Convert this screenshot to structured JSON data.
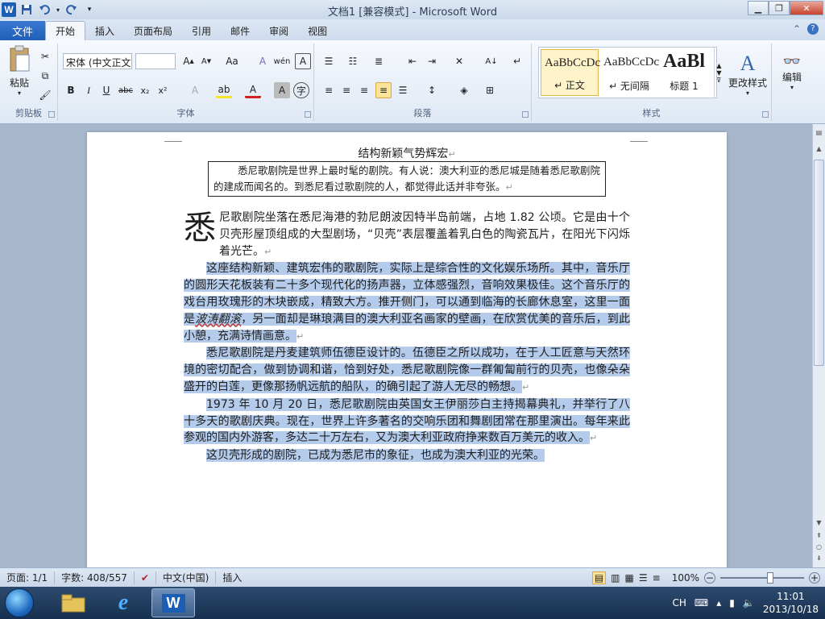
{
  "window": {
    "title": "文档1 [兼容模式] - Microsoft Word",
    "app_logo": "W"
  },
  "quick_access": {
    "icons": [
      "word-logo",
      "save-icon",
      "undo-icon",
      "redo-icon",
      "customize-icon"
    ]
  },
  "tabs": {
    "file": "文件",
    "items": [
      "开始",
      "插入",
      "页面布局",
      "引用",
      "邮件",
      "审阅",
      "视图"
    ],
    "active_index": 0
  },
  "ribbon": {
    "clipboard": {
      "label": "剪贴板",
      "paste": "粘贴"
    },
    "font": {
      "label": "字体",
      "font_name": "宋体 (中文正文)",
      "font_size": ""
    },
    "paragraph": {
      "label": "段落"
    },
    "styles": {
      "label": "样式",
      "items": [
        {
          "preview": "AaBbCcDc",
          "caption": "↵ 正文"
        },
        {
          "preview": "AaBbCcDc",
          "caption": "↵ 无间隔"
        },
        {
          "preview": "AaBl",
          "caption": "标题 1"
        }
      ],
      "change_styles": "更改样式"
    },
    "editing": {
      "label": "编辑"
    }
  },
  "document": {
    "title": "结构新颖气势辉宏",
    "quote": "悉尼歌剧院是世界上最时髦的剧院。有人说：澳大利亚的悉尼城是随着悉尼歌剧院的建成而闻名的。到悉尼看过歌剧院的人，都觉得此话并非夸张。",
    "p1_dropcap": "悉",
    "p1": "尼歌剧院坐落在悉尼海港的勃尼朗波因特半岛前端，占地 1.82 公顷。它是由十个贝壳形屋顶组成的大型剧场，“贝壳”表层覆盖着乳白色的陶瓷瓦片，在阳光下闪烁着光芒。",
    "p2a": "这座结构新颖、建筑宏伟的歌剧院，实际上是综合性的文化娱乐场所。其中，音乐厅的圆形天花板装有二十多个现代化的扬声器，立体感强烈，音响效果极佳。这个音乐厅的戏台用玫瑰形的木块嵌成，精致大方。推开侧门，可以通到临海的长廊休息室，这里一面是",
    "p2_em": "波涛翻滚",
    "p2b": "，另一面却是琳琅满目的澳大利亚名画家的壁画，在欣赏优美的音乐后，到此小憩，充满诗情画意。",
    "p3": "悉尼歌剧院是丹麦建筑师伍德臣设计的。伍德臣之所以成功，在于人工匠意与天然环境的密切配合，做到协调和谐，恰到好处，悉尼歌剧院像一群匍匐前行的贝壳，也像朵朵盛开的白莲，更像那扬帆远航的船队，的确引起了游人无尽的畅想。",
    "p4": "1973 年 10 月 20 日，悉尼歌剧院由英国女王伊丽莎白主持揭幕典礼，并举行了八十多天的歌剧庆典。现在，世界上许多著名的交响乐团和舞剧团常在那里演出。每年来此参观的国内外游客，多达二十万左右，又为澳大利亚政府挣来数百万美元的收入。",
    "p5": "这贝壳形成的剧院，已成为悉尼市的象征，也成为澳大利亚的光荣。",
    "para_mark": "↵"
  },
  "status": {
    "page": "页面: 1/1",
    "words": "字数: 408/557",
    "language": "中文(中国)",
    "mode": "插入",
    "zoom": "100%",
    "zoom_minus": "−",
    "zoom_plus": "+"
  },
  "taskbar": {
    "ime": "CH",
    "time": "11:01",
    "date": "2013/10/18"
  },
  "colors": {
    "file_tab": "#1f5fb8",
    "selection": "#b4cbec"
  }
}
